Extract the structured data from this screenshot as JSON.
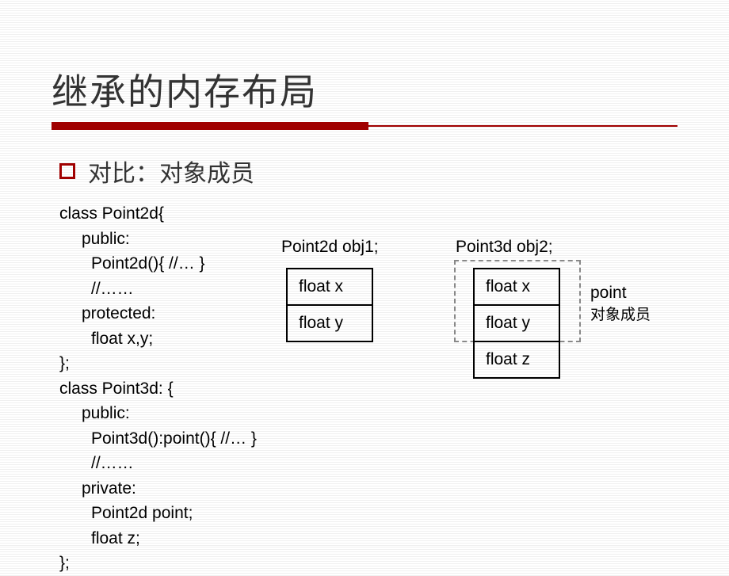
{
  "title": "继承的内存布局",
  "bullet": "对比：对象成员",
  "code": {
    "l0": "class Point2d{",
    "l1": "public:",
    "l2": "Point2d(){ //… }",
    "l3": "//……",
    "l4": "protected:",
    "l5": "float x,y;",
    "l6": "};",
    "l7": "class Point3d: {",
    "l8": "public:",
    "l9": "Point3d():point(){ //… }",
    "l10": "//……",
    "l11": "private:",
    "l12": "Point2d  point;",
    "l13": "float z;",
    "l14": "};"
  },
  "diagram": {
    "obj1_label": "Point2d  obj1;",
    "obj2_label": "Point3d  obj2;",
    "cell_x": "float x",
    "cell_y": "float y",
    "cell_z": "float z",
    "annotation_top": "point",
    "annotation_sub": "对象成员"
  }
}
